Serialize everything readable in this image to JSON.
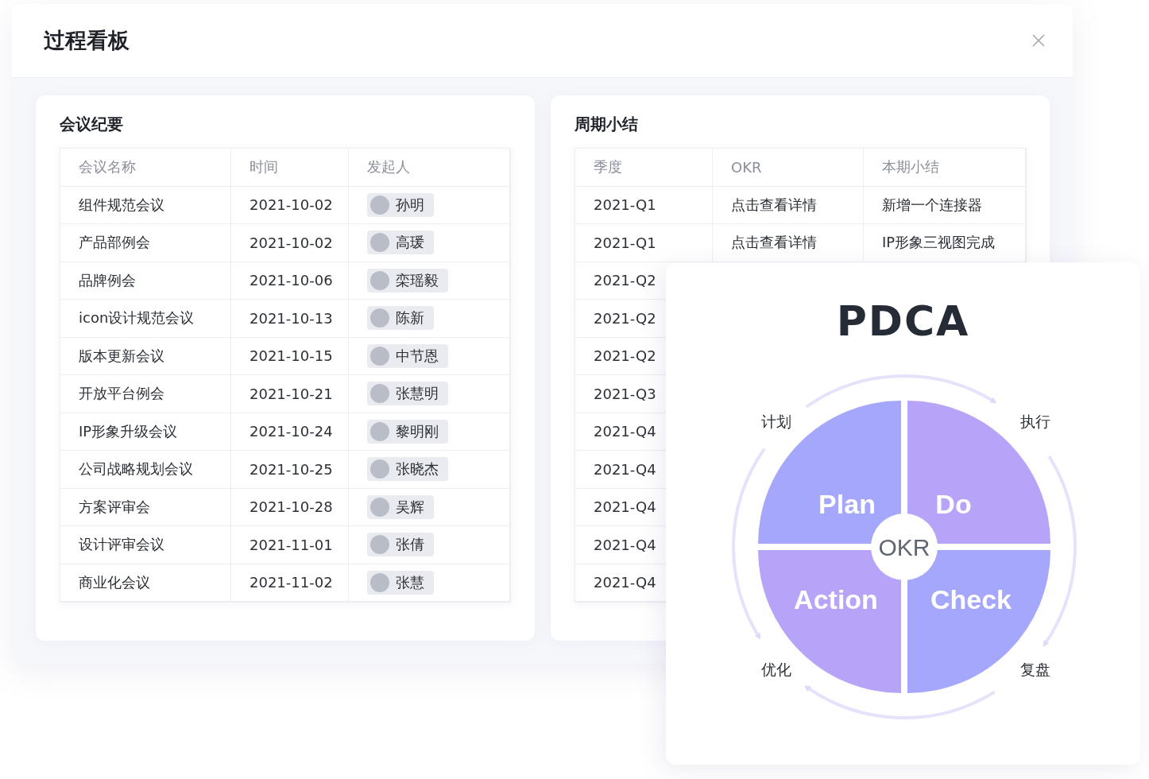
{
  "window": {
    "title": "过程看板"
  },
  "meeting_minutes": {
    "title": "会议纪要",
    "columns": [
      "会议名称",
      "时间",
      "发起人"
    ],
    "rows": [
      {
        "name": "组件规范会议",
        "time": "2021-10-02",
        "host": "孙明"
      },
      {
        "name": "产品部例会",
        "time": "2021-10-02",
        "host": "高瑗"
      },
      {
        "name": "品牌例会",
        "time": "2021-10-06",
        "host": "栾瑶毅"
      },
      {
        "name": "icon设计规范会议",
        "time": "2021-10-13",
        "host": "陈新"
      },
      {
        "name": "版本更新会议",
        "time": "2021-10-15",
        "host": "中节恩"
      },
      {
        "name": "开放平台例会",
        "time": "2021-10-21",
        "host": "张慧明"
      },
      {
        "name": "IP形象升级会议",
        "time": "2021-10-24",
        "host": "黎明刚"
      },
      {
        "name": "公司战略规划会议",
        "time": "2021-10-25",
        "host": "张晓杰"
      },
      {
        "name": "方案评审会",
        "time": "2021-10-28",
        "host": "吴辉"
      },
      {
        "name": "设计评审会议",
        "time": "2021-11-01",
        "host": "张倩"
      },
      {
        "name": "商业化会议",
        "time": "2021-11-02",
        "host": "张慧"
      }
    ]
  },
  "cycle_summary": {
    "title": "周期小结",
    "columns": [
      "季度",
      "OKR",
      "本期小结"
    ],
    "rows": [
      {
        "quarter": "2021-Q1",
        "okr": "点击查看详情",
        "summary": "新增一个连接器"
      },
      {
        "quarter": "2021-Q1",
        "okr": "点击查看详情",
        "summary": "IP形象三视图完成"
      },
      {
        "quarter": "2021-Q2"
      },
      {
        "quarter": "2021-Q2"
      },
      {
        "quarter": "2021-Q2"
      },
      {
        "quarter": "2021-Q3"
      },
      {
        "quarter": "2021-Q4"
      },
      {
        "quarter": "2021-Q4"
      },
      {
        "quarter": "2021-Q4"
      },
      {
        "quarter": "2021-Q4"
      },
      {
        "quarter": "2021-Q4"
      }
    ]
  },
  "pdca": {
    "title": "PDCA",
    "center": "OKR",
    "quadrants": [
      {
        "label": "Plan",
        "color": "#a4a7fb"
      },
      {
        "label": "Do",
        "color": "#b7a4f9"
      },
      {
        "label": "Action",
        "color": "#b7a4f9"
      },
      {
        "label": "Check",
        "color": "#a4a7fb"
      }
    ],
    "stages": [
      "计划",
      "执行",
      "优化",
      "复盘"
    ]
  }
}
